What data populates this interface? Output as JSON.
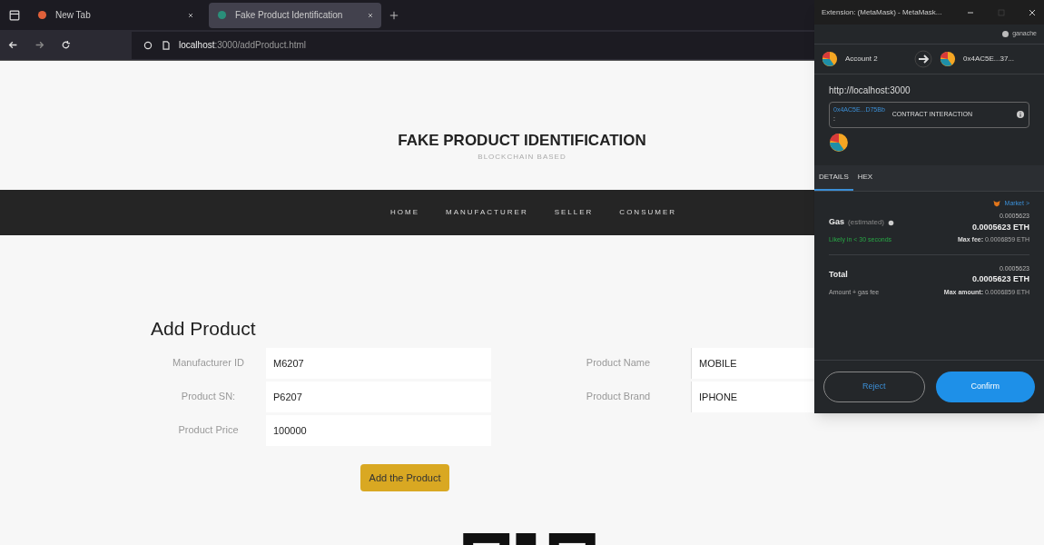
{
  "browser": {
    "tabs": [
      {
        "title": "New Tab",
        "selected": false
      },
      {
        "title": "Fake Product Identification",
        "selected": true
      }
    ],
    "url_host": "localhost",
    "url_path": ":3000/addProduct.html"
  },
  "site": {
    "title": "FAKE PRODUCT IDENTIFICATION",
    "subtitle": "BLOCKCHAIN BASED",
    "nav": [
      "HOME",
      "MANUFACTURER",
      "SELLER",
      "CONSUMER"
    ]
  },
  "form": {
    "heading": "Add Product",
    "left_fields": [
      {
        "label": "Manufacturer ID",
        "value": "M6207"
      },
      {
        "label": "Product SN:",
        "value": "P6207"
      },
      {
        "label": "Product Price",
        "value": "100000"
      }
    ],
    "right_fields": [
      {
        "label": "Product Name",
        "value": "MOBILE"
      },
      {
        "label": "Product Brand",
        "value": "IPHONE"
      }
    ],
    "submit": "Add the Product"
  },
  "popup": {
    "title": "Extension: (MetaMask) - MetaMask...",
    "network": "ganache",
    "from": "Account 2",
    "to": "0x4AC5E...37...",
    "origin": "http://localhost:3000",
    "contract_address": "0x4AC5E...D75Bb",
    "contract_colon": ":",
    "contract_label": "CONTRACT INTERACTION",
    "tabs": [
      {
        "label": "DETAILS",
        "selected": true
      },
      {
        "label": "HEX",
        "selected": false
      }
    ],
    "market": "Market >",
    "gas": {
      "label": "Gas",
      "note": "(estimated)",
      "small": "0.0005623",
      "amount": "0.0005623 ETH",
      "speed": "Likely in < 30 seconds",
      "max_label": "Max fee:",
      "max": "0.0006859 ETH"
    },
    "total": {
      "label": "Total",
      "small": "0.0005623",
      "amount": "0.0005623 ETH",
      "note": "Amount + gas fee",
      "max_label": "Max amount:",
      "max": "0.0006859 ETH"
    },
    "buttons": [
      "Reject",
      "Confirm"
    ]
  }
}
